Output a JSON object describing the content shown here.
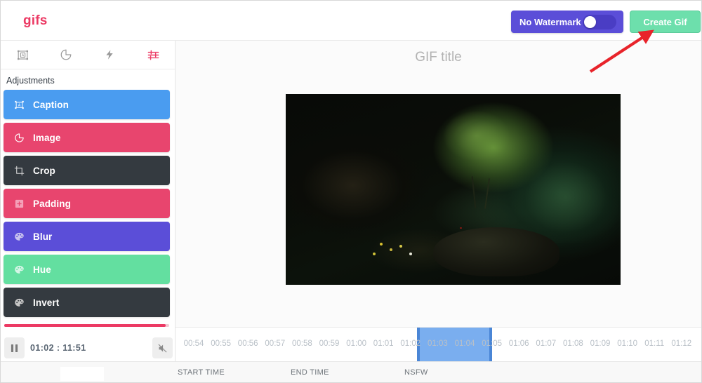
{
  "header": {
    "logo": "gifs",
    "watermark_label": "No Watermark",
    "watermark_on": false,
    "create_button": "Create Gif",
    "create_button_color": "#6ddfac",
    "toggle_color": "#5b4ed8",
    "logo_color": "#ec3a64"
  },
  "sidebar": {
    "tabs": [
      {
        "name": "caption-tab",
        "icon": "text-frame-icon",
        "active": false
      },
      {
        "name": "image-tab",
        "icon": "pie-shape-icon",
        "active": false
      },
      {
        "name": "effects-tab",
        "icon": "lightning-bolt-icon",
        "active": false
      },
      {
        "name": "adjustments-tab",
        "icon": "sliders-icon",
        "active": true
      }
    ],
    "section_title": "Adjustments",
    "items": [
      {
        "label": "Caption",
        "icon": "text-frame-icon",
        "color": "#4a9cf0"
      },
      {
        "label": "Image",
        "icon": "pie-shape-icon",
        "color": "#e8456e"
      },
      {
        "label": "Crop",
        "icon": "crop-icon",
        "color": "#343a40"
      },
      {
        "label": "Padding",
        "icon": "plus-square-icon",
        "color": "#e8456e"
      },
      {
        "label": "Blur",
        "icon": "palette-icon",
        "color": "#5b4ed8"
      },
      {
        "label": "Hue",
        "icon": "palette-icon",
        "color": "#63dfa0"
      },
      {
        "label": "Invert",
        "icon": "palette-icon",
        "color": "#343a40"
      }
    ],
    "playback": {
      "play_state": "pause",
      "current_time": "01:02",
      "separator": ":",
      "total_time": "11:51",
      "time_display": "01:02 : 11:51",
      "muted": true,
      "progress_percent": 98,
      "progress_color": "#ec3a64"
    }
  },
  "main": {
    "gif_title_placeholder": "GIF title",
    "preview_alt": "dark forest scene with small tree on mossy rock over water"
  },
  "timeline": {
    "ticks": [
      "00:54",
      "00:55",
      "00:56",
      "00:57",
      "00:58",
      "00:59",
      "01:00",
      "01:01",
      "01:02",
      "01:03",
      "01:04",
      "01:05",
      "01:06",
      "01:07",
      "01:08",
      "01:09",
      "01:10",
      "01:11",
      "01:12"
    ],
    "selection_start": "01:02",
    "selection_end": "01:05",
    "selection_color": "#5d9cec"
  },
  "bottombar": {
    "labels": [
      "START TIME",
      "END TIME",
      "NSFW"
    ]
  },
  "annotation": {
    "arrow_color": "#e8232a",
    "points_to": "create-gif-button"
  }
}
